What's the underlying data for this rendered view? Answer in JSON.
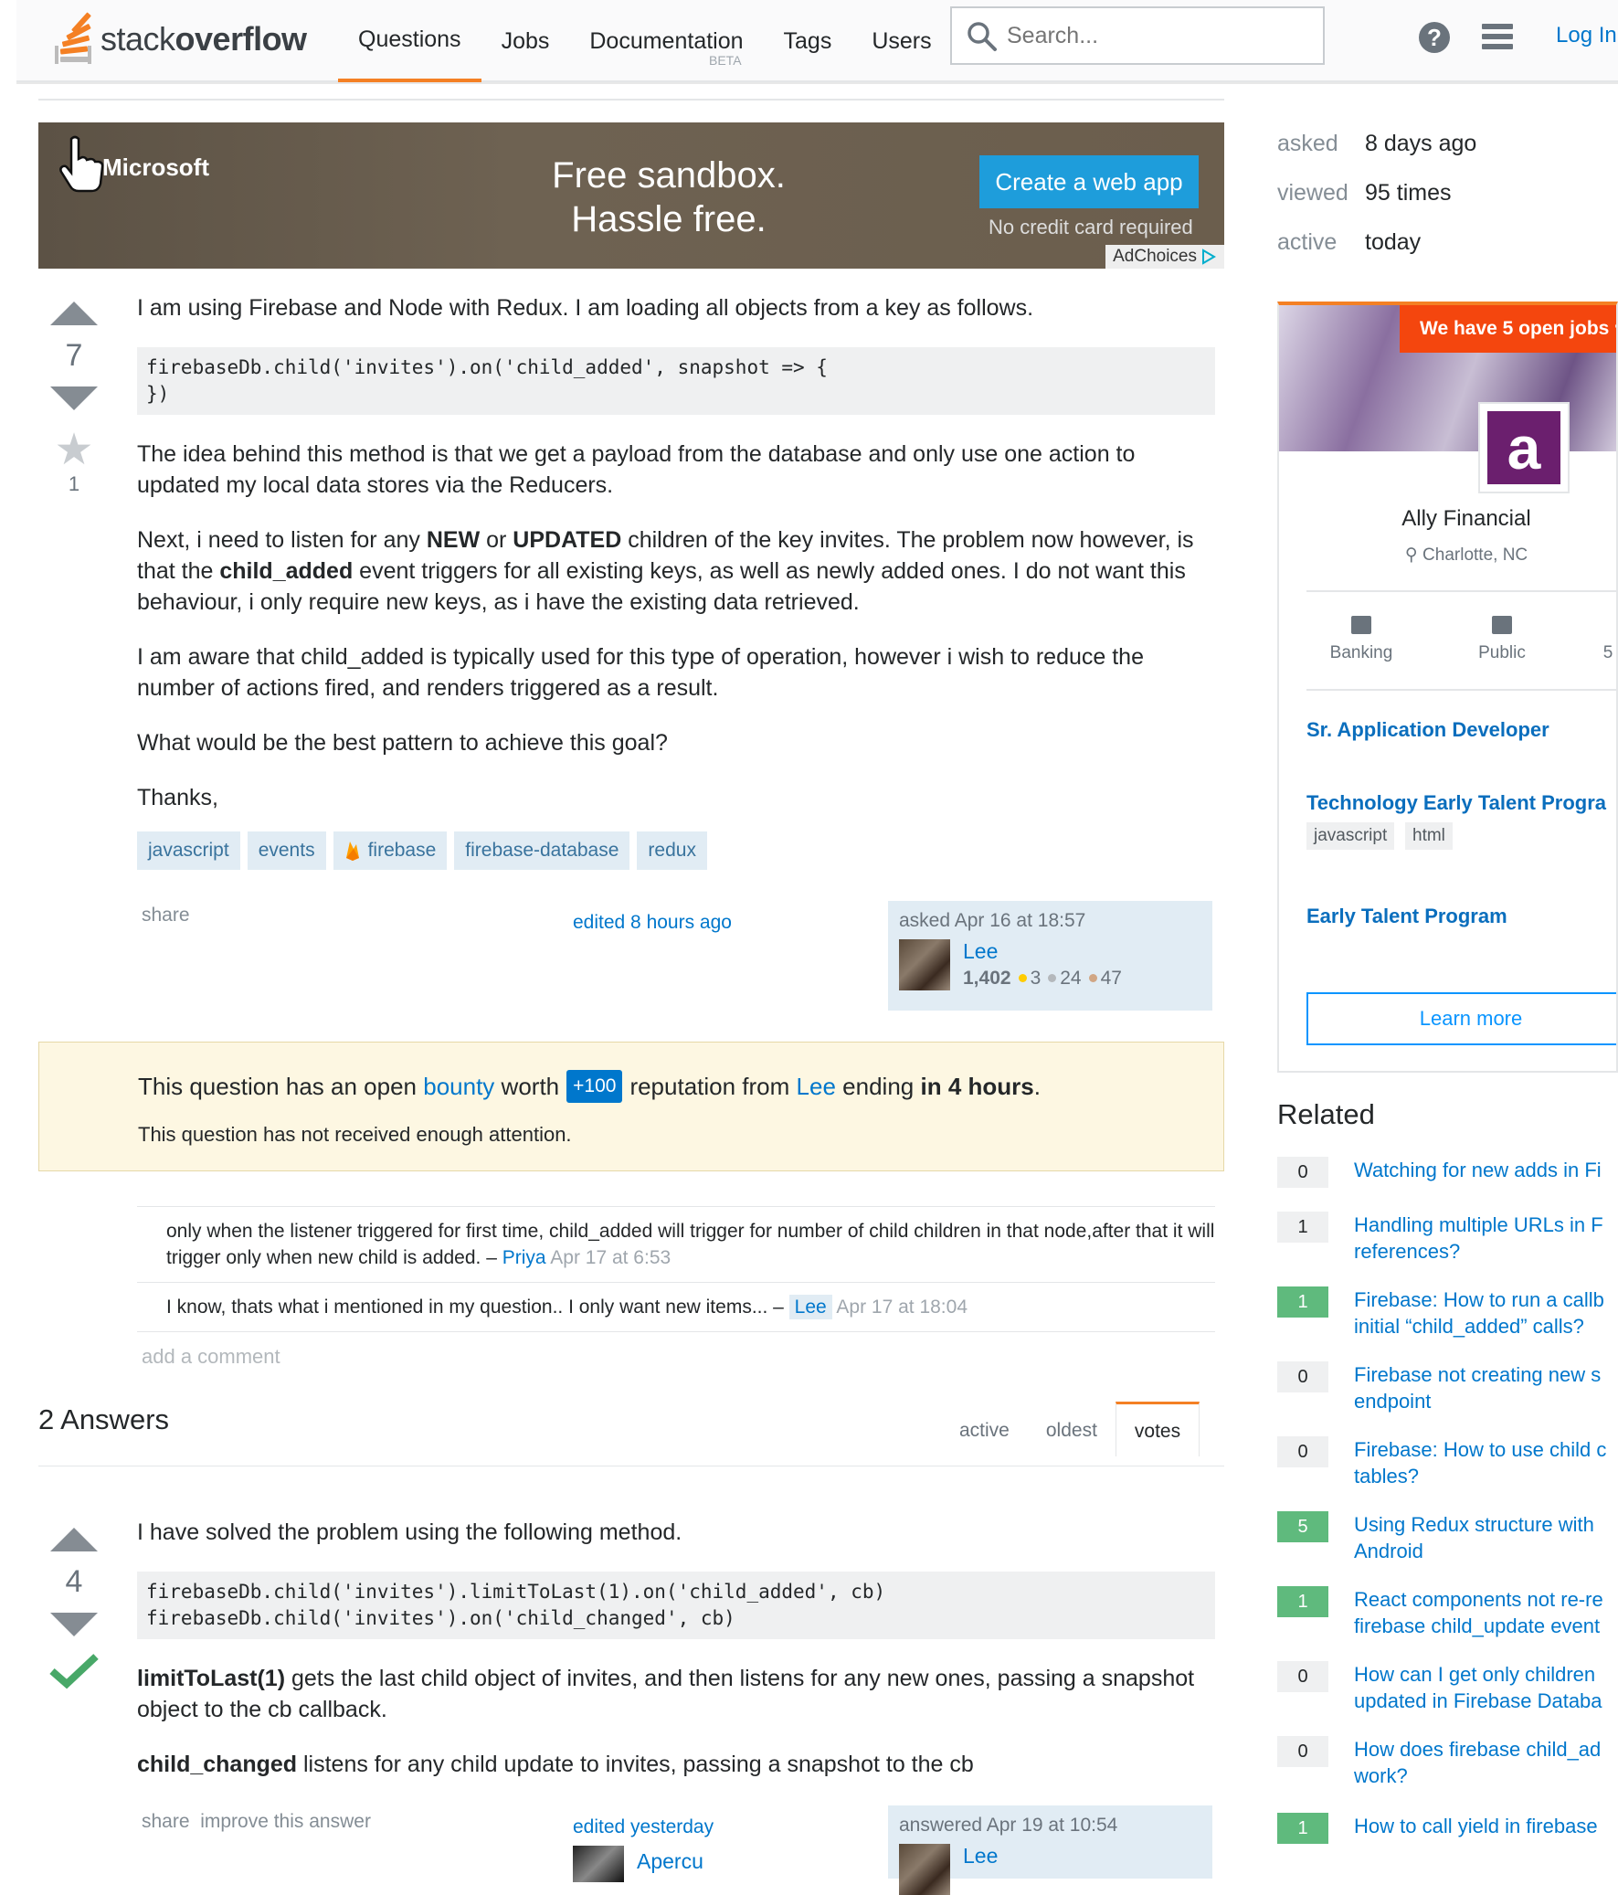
{
  "header": {
    "logo_light": "stack",
    "logo_bold": "overflow",
    "nav": [
      {
        "label": "Questions",
        "active": true
      },
      {
        "label": "Jobs"
      },
      {
        "label": "Documentation",
        "badge": "BETA"
      },
      {
        "label": "Tags"
      },
      {
        "label": "Users"
      }
    ],
    "search_placeholder": "Search...",
    "help_glyph": "?",
    "login": "Log In"
  },
  "ad": {
    "brand": "Microsoft",
    "title_line1": "Free sandbox.",
    "title_line2": "Hassle free.",
    "button": "Create a web app",
    "note": "No credit card required",
    "adchoices": "AdChoices"
  },
  "question": {
    "votes": "7",
    "favorites": "1",
    "p1": "I am using Firebase and Node with Redux. I am loading all objects from a key as follows.",
    "code1_line1": "firebaseDb.child('invites').on('child_added', snapshot => {",
    "code1_line2": "})",
    "p2": "The idea behind this method is that we get a payload from the database and only use one action to updated my local data stores via the Reducers.",
    "p3_a": "Next, i need to listen for any ",
    "p3_b": "NEW",
    "p3_c": " or ",
    "p3_d": "UPDATED",
    "p3_e": " children of the key invites. The problem now however, is that the ",
    "p3_f": "child_added",
    "p3_g": " event triggers for all existing keys, as well as newly added ones. I do not want this behaviour, i only require new keys, as i have the existing data retrieved.",
    "p4": "I am aware that child_added is typically used for this type of operation, however i wish to reduce the number of actions fired, and renders triggered as a result.",
    "p5": "What would be the best pattern to achieve this goal?",
    "p6": "Thanks,",
    "tags": [
      "javascript",
      "events",
      "firebase",
      "firebase-database",
      "redux"
    ],
    "share": "share",
    "edited": "edited 8 hours ago",
    "asked": "asked Apr 16 at 18:57",
    "user": "Lee",
    "rep": "1,402",
    "gold": "3",
    "silver": "24",
    "bronze": "47"
  },
  "bounty": {
    "t1": "This question has an open ",
    "link": "bounty",
    "t2": " worth ",
    "amount": "+100",
    "t3": " reputation from ",
    "user": "Lee",
    "t4": " ending ",
    "t5": "in 4 hours",
    "t6": ".",
    "sub": "This question has not received enough attention."
  },
  "comments": [
    {
      "text": "only when the listener triggered for first time, child_added will trigger for number of child children in that node,after that it will trigger only when new child is added. – ",
      "user": "Priya",
      "time": " Apr 17 at 6:53"
    },
    {
      "text": "I know, thats what i mentioned in my question.. I only want new items... – ",
      "user": "Lee",
      "time": " Apr 17 at 18:04"
    }
  ],
  "add_comment": "add a comment",
  "answers": {
    "heading": "2 Answers",
    "tabs": [
      "active",
      "oldest",
      "votes"
    ],
    "votes": "4",
    "p1": "I have solved the problem using the following method.",
    "code_line1": "firebaseDb.child('invites').limitToLast(1).on('child_added', cb)",
    "code_line2": "firebaseDb.child('invites').on('child_changed', cb)",
    "p2_b": "limitToLast(1)",
    "p2": " gets the last child object of invites, and then listens for any new ones, passing a snapshot object to the cb callback.",
    "p3_b": "child_changed",
    "p3": " listens for any child update to invites, passing a snapshot to the cb",
    "menu": "share  improve this answer",
    "edited": "edited yesterday",
    "editor": "Apercu",
    "answered": "answered Apr 19 at 10:54",
    "user": "Lee"
  },
  "sidebar": {
    "asked_k": "asked",
    "asked_v": "8 days ago",
    "viewed_k": "viewed",
    "viewed_v": "95 times",
    "active_k": "active",
    "active_v": "today",
    "job": {
      "banner": "We have 5 open jobs ♥",
      "company": "Ally Financial",
      "location": "Charlotte, NC",
      "cat1": "Banking",
      "cat2": "Public",
      "cat3": "5",
      "job1": "Sr. Application Developer",
      "job2": "Technology Early Talent Progra",
      "chips": [
        "javascript",
        "html"
      ],
      "job3": "Early Talent Program",
      "learn": "Learn more"
    },
    "related_heading": "Related",
    "related": [
      {
        "score": "0",
        "accepted": false,
        "l1": "Watching for new adds in Fi",
        "l2": ""
      },
      {
        "score": "1",
        "accepted": false,
        "l1": "Handling multiple URLs in F",
        "l2": "references?"
      },
      {
        "score": "1",
        "accepted": true,
        "l1": "Firebase: How to run a callb",
        "l2": "initial “child_added” calls?"
      },
      {
        "score": "0",
        "accepted": false,
        "l1": "Firebase not creating new s",
        "l2": "endpoint"
      },
      {
        "score": "0",
        "accepted": false,
        "l1": "Firebase: How to use child c",
        "l2": "tables?"
      },
      {
        "score": "5",
        "accepted": true,
        "l1": "Using Redux structure with",
        "l2": "Android"
      },
      {
        "score": "1",
        "accepted": true,
        "l1": "React components not re-re",
        "l2": "firebase child_update event"
      },
      {
        "score": "0",
        "accepted": false,
        "l1": "How can I get only children",
        "l2": "updated in Firebase Databa"
      },
      {
        "score": "0",
        "accepted": false,
        "l1": "How does firebase child_ad",
        "l2": "work?"
      },
      {
        "score": "1",
        "accepted": true,
        "l1": "How to call yield in firebase",
        "l2": ""
      }
    ]
  }
}
